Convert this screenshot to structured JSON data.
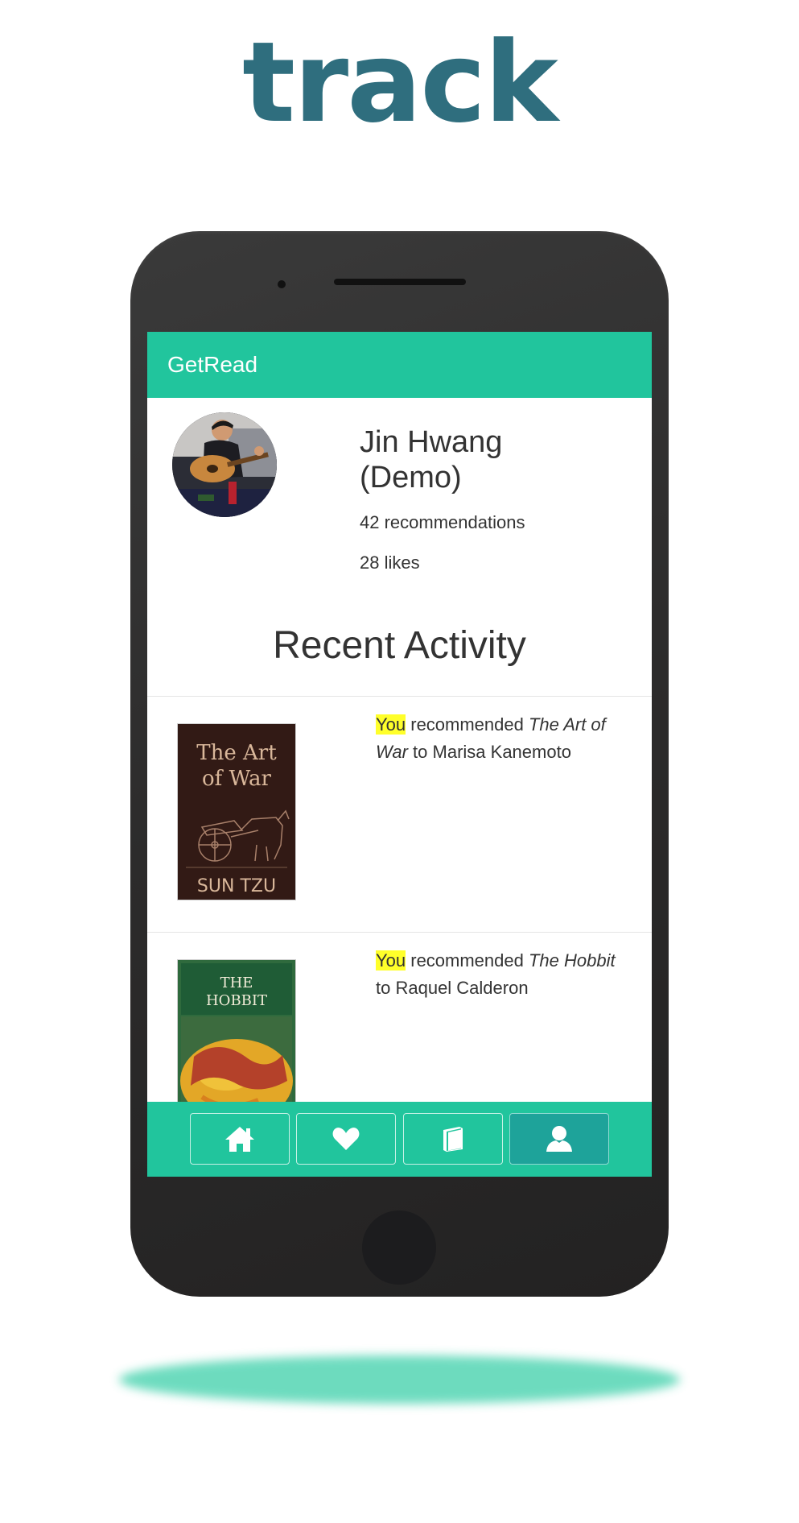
{
  "headline": "track",
  "app": {
    "brand": "GetRead"
  },
  "profile": {
    "name": "Jin Hwang (Demo)",
    "recommendations": "42 recommendations",
    "likes": "28 likes"
  },
  "section_title": "Recent Activity",
  "activity": [
    {
      "actor": "You",
      "verb": " recommended ",
      "book": "The Art of War",
      "preposition": " to ",
      "recipient": "Marisa Kanemoto",
      "cover": {
        "title_line1": "The Art",
        "title_line2": "of War",
        "author": "SUN TZU"
      }
    },
    {
      "actor": "You",
      "verb": " recommended ",
      "book": "The Hobbit",
      "preposition": " to ",
      "recipient": "Raquel Calderon",
      "cover": {
        "title_line1": "THE",
        "title_line2": "HOBBIT"
      }
    }
  ],
  "tabs": [
    {
      "icon": "home-icon",
      "active": false
    },
    {
      "icon": "heart-icon",
      "active": false
    },
    {
      "icon": "book-icon",
      "active": false
    },
    {
      "icon": "user-icon",
      "active": true
    }
  ],
  "colors": {
    "headline": "#2f6e7e",
    "accent": "#21c59d",
    "active_tab": "#1ea39a",
    "highlight": "#ffff2a",
    "phone_body": "#2c2b2b",
    "shadow": "#5ed8b8"
  }
}
